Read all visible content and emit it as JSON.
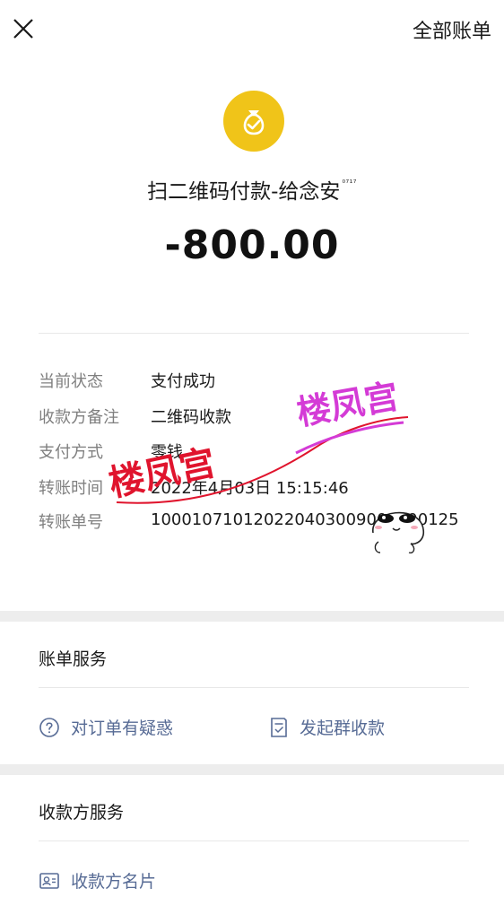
{
  "header": {
    "all_bills_label": "全部账单"
  },
  "transaction": {
    "title": "扫二维码付款-给念安",
    "title_sup": "⁰⁷¹⁷",
    "amount": "-800.00"
  },
  "details": [
    {
      "label": "当前状态",
      "value": "支付成功"
    },
    {
      "label": "收款方备注",
      "value": "二维码收款"
    },
    {
      "label": "支付方式",
      "value": "零钱"
    },
    {
      "label": "转账时间",
      "value": "2022年4月03日 15:15:46"
    },
    {
      "label": "转账单号",
      "value": "100010710120220403009000000125"
    }
  ],
  "bill_service": {
    "title": "账单服务",
    "question_label": "对订单有疑惑",
    "group_collect_label": "发起群收款"
  },
  "payee_service": {
    "title": "收款方服务",
    "card_label": "收款方名片"
  },
  "watermarks": {
    "text_top": "楼凤宫",
    "text_bottom": "楼凤宫"
  },
  "colors": {
    "link": "#576b95",
    "icon_yellow": "#f0c419",
    "label_gray": "#7f7f7f",
    "watermark_magenta": "#d43bd6",
    "watermark_red": "#e0142d"
  },
  "icons": {
    "close": "close-icon",
    "merchant": "money-bag-icon",
    "question": "question-circle-icon",
    "group_collect": "receipt-icon",
    "card": "contact-card-icon"
  }
}
